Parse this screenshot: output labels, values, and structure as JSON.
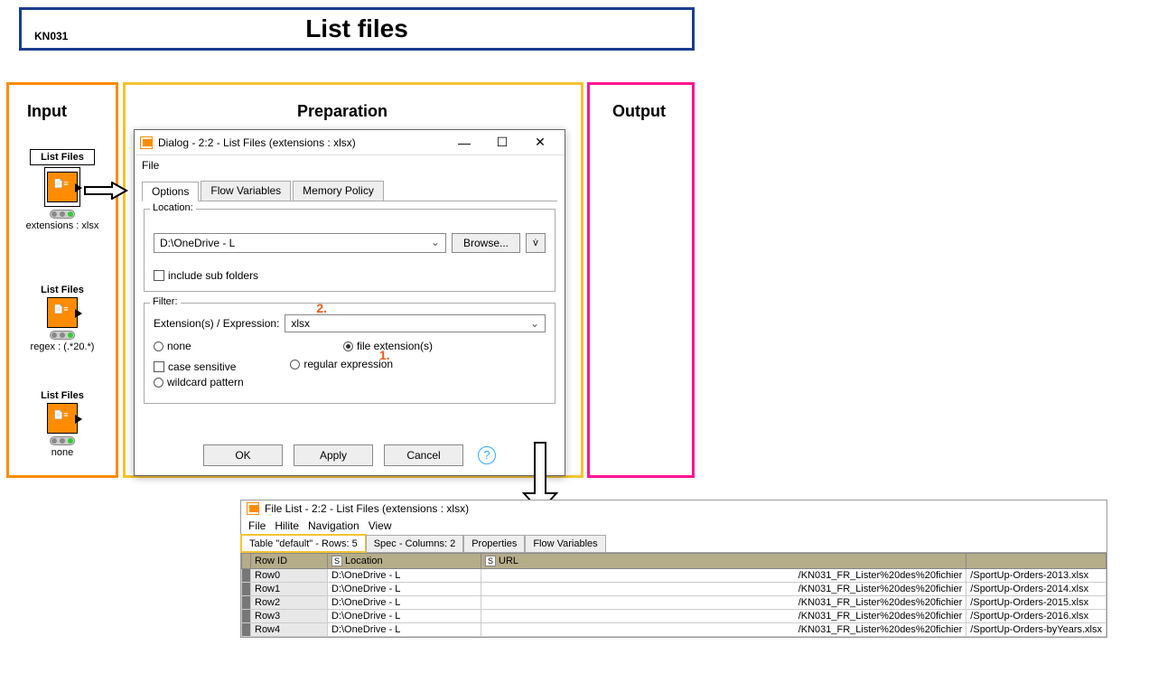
{
  "title_box": {
    "code": "KN031",
    "title": "List files"
  },
  "sections": {
    "input": "Input",
    "preparation": "Preparation",
    "output": "Output"
  },
  "nodes": {
    "n1": {
      "label": "List Files",
      "caption": "extensions : xlsx"
    },
    "n2": {
      "label": "List Files",
      "caption": "regex : (.*20.*)"
    },
    "n3": {
      "label": "List Files",
      "caption": "none"
    }
  },
  "dialog": {
    "title": "Dialog - 2:2 - List Files (extensions : xlsx)",
    "menu_file": "File",
    "tabs": {
      "options": "Options",
      "flow": "Flow Variables",
      "memory": "Memory Policy"
    },
    "location": {
      "legend": "Location:",
      "path": "D:\\OneDrive - L",
      "browse": "Browse...",
      "include_sub": "include sub folders"
    },
    "filter": {
      "legend": "Filter:",
      "ext_label": "Extension(s) / Expression:",
      "ext_value": "xlsx",
      "none": "none",
      "file_ext": "file extension(s)",
      "case_sens": "case sensitive",
      "regex": "regular expression",
      "wildcard": "wildcard pattern"
    },
    "buttons": {
      "ok": "OK",
      "apply": "Apply",
      "cancel": "Cancel"
    },
    "annotation1": "1.",
    "annotation2": "2."
  },
  "results": {
    "title": "File List - 2:2 - List Files (extensions : xlsx)",
    "menu": {
      "file": "File",
      "hilite": "Hilite",
      "nav": "Navigation",
      "view": "View"
    },
    "tabs": {
      "table": "Table \"default\" - Rows: 5",
      "spec": "Spec - Columns: 2",
      "props": "Properties",
      "flow": "Flow Variables"
    },
    "columns": {
      "rowid": "Row ID",
      "location": "Location",
      "url": "URL"
    },
    "rows": [
      {
        "id": "Row0",
        "loc": "D:\\OneDrive - L",
        "urlpre": "/KN031_FR_Lister%20des%20fichier",
        "file": "/SportUp-Orders-2013.xlsx"
      },
      {
        "id": "Row1",
        "loc": "D:\\OneDrive - L",
        "urlpre": "/KN031_FR_Lister%20des%20fichier",
        "file": "/SportUp-Orders-2014.xlsx"
      },
      {
        "id": "Row2",
        "loc": "D:\\OneDrive - L",
        "urlpre": "/KN031_FR_Lister%20des%20fichier",
        "file": "/SportUp-Orders-2015.xlsx"
      },
      {
        "id": "Row3",
        "loc": "D:\\OneDrive - L",
        "urlpre": "/KN031_FR_Lister%20des%20fichier",
        "file": "/SportUp-Orders-2016.xlsx"
      },
      {
        "id": "Row4",
        "loc": "D:\\OneDrive - L",
        "urlpre": "/KN031_FR_Lister%20des%20fichier",
        "file": "/SportUp-Orders-byYears.xlsx"
      }
    ]
  }
}
